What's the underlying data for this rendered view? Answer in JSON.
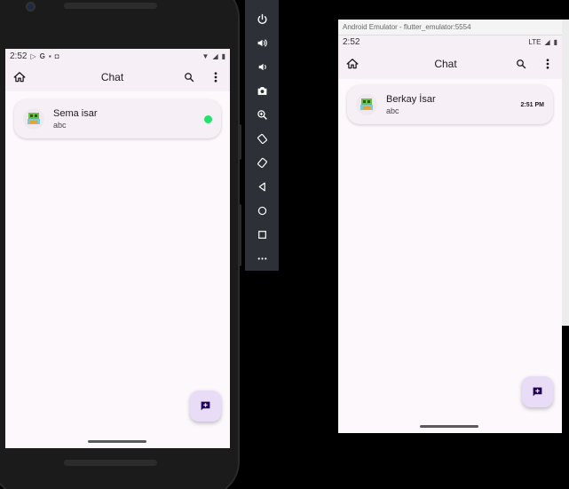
{
  "left_device": {
    "status": {
      "time": "2:52"
    },
    "app_bar": {
      "title": "Chat"
    },
    "chats": [
      {
        "name": "Sema isar",
        "message": "abc",
        "online": true
      }
    ]
  },
  "toolbar": {
    "tools": [
      "power-icon",
      "volume-up-icon",
      "volume-down-icon",
      "camera-icon",
      "zoom-icon",
      "rotate-left-icon",
      "rotate-right-icon",
      "back-icon",
      "home-icon",
      "overview-icon",
      "more-icon"
    ]
  },
  "right_device": {
    "window_title": "Android Emulator - flutter_emulator:5554",
    "status": {
      "time": "2:52",
      "network": "LTE"
    },
    "app_bar": {
      "title": "Chat"
    },
    "chats": [
      {
        "name": "Berkay İsar",
        "message": "abc",
        "time": "2:51 PM"
      }
    ]
  },
  "colors": {
    "accent_fab": "#e9dcf6",
    "online": "#22e36a",
    "background": "#fdf8fc"
  }
}
